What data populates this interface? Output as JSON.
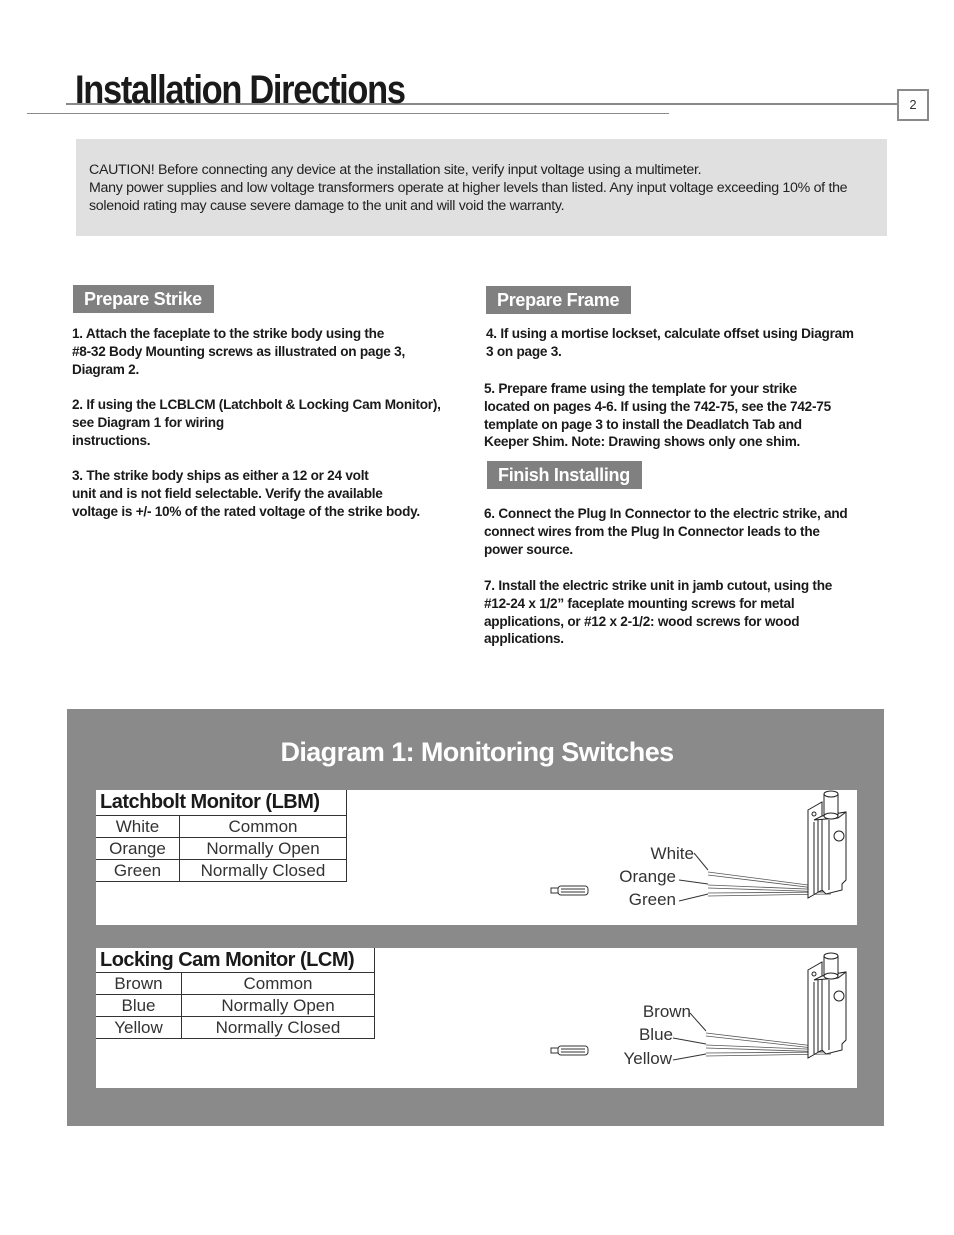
{
  "header": {
    "title": "Installation Directions",
    "page_number": "2"
  },
  "caution": {
    "text": "CAUTION! Before connecting any device at the installation site, verify input voltage using a multimeter.\nMany  power supplies and low voltage transformers operate at higher levels than listed. Any input voltage exceeding 10% of the solenoid rating may cause severe damage to the unit and will void the warranty."
  },
  "sections": {
    "prepare_strike": {
      "heading": "Prepare Strike",
      "steps": [
        "1. Attach the faceplate to the strike body using the\n   #8-32 Body Mounting screws as illustrated on page 3,\n   Diagram 2.",
        "2. If using the LCBLCM (Latchbolt & Locking Cam Monitor),\n   see Diagram 1 for wiring\n   instructions.",
        "3. The strike body ships as either a 12 or 24 volt\n    unit and is not field selectable.   Verify the available\n    voltage is +/- 10% of the rated voltage of the strike body."
      ]
    },
    "prepare_frame": {
      "heading": "Prepare Frame",
      "steps": [
        "4. If using a mortise lockset, calculate offset using Diagram\n    3 on page 3.",
        "5. Prepare frame using the template for your strike\n    located on pages 4-6.  If using the 742-75, see the 742-75\n    template on page 3 to install the Deadlatch Tab and\n    Keeper Shim.  Note: Drawing shows only one shim."
      ]
    },
    "finish_installing": {
      "heading": "Finish Installing",
      "steps": [
        "6. Connect the Plug In Connector to the electric strike, and\n    connect wires from the Plug In Connector leads to the\n    power source.",
        "7. Install the electric strike unit in jamb cutout, using the\n    #12-24 x 1/2” faceplate mounting screws for metal\n    applications, or #12 x 2-1/2: wood screws for wood\n    applications."
      ]
    }
  },
  "diagram": {
    "title": "Diagram 1: Monitoring Switches",
    "lbm": {
      "title": "Latchbolt Monitor (LBM)",
      "rows": [
        {
          "wire": "White",
          "function": "Common"
        },
        {
          "wire": "Orange",
          "function": "Normally Open"
        },
        {
          "wire": "Green",
          "function": "Normally Closed"
        }
      ],
      "labels": [
        "White",
        "Orange",
        "Green"
      ]
    },
    "lcm": {
      "title": "Locking Cam Monitor (LCM)",
      "rows": [
        {
          "wire": "Brown",
          "function": "Common"
        },
        {
          "wire": "Blue",
          "function": "Normally Open"
        },
        {
          "wire": "Yellow",
          "function": "Normally Closed"
        }
      ],
      "labels": [
        "Brown",
        "Blue",
        "Yellow"
      ]
    }
  },
  "colors": {
    "section_header_bg": "#808080",
    "caution_bg": "#e0e0e0",
    "diagram_bg": "#8a8a8a"
  }
}
